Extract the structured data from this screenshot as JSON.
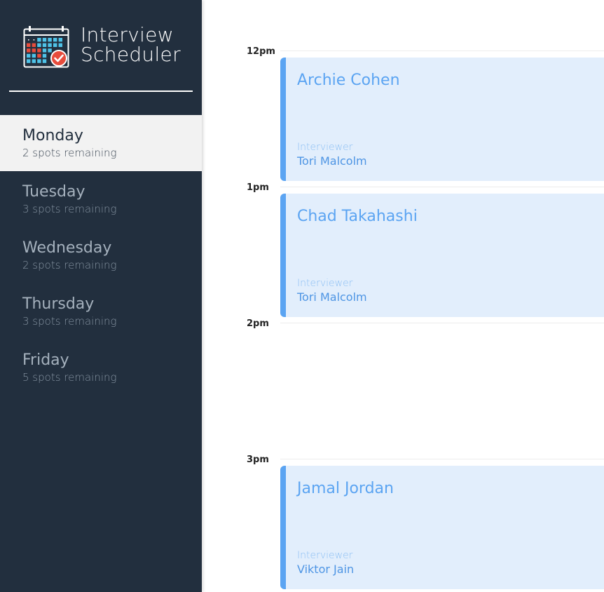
{
  "app": {
    "title_line1": "Interview",
    "title_line2": "Scheduler",
    "logo_icon": "calendar-check-icon"
  },
  "colors": {
    "sidebar_bg": "#222f3e",
    "selected_bg": "#f2f2f2",
    "card_bg": "#e2eefc",
    "accent_blue": "#5ba4f2",
    "calendar_red": "#e74c3c",
    "calendar_cyan": "#4fc3e8"
  },
  "days": [
    {
      "name": "Monday",
      "spots": "2 spots remaining",
      "selected": true
    },
    {
      "name": "Tuesday",
      "spots": "3 spots remaining",
      "selected": false
    },
    {
      "name": "Wednesday",
      "spots": "2 spots remaining",
      "selected": false
    },
    {
      "name": "Thursday",
      "spots": "3 spots remaining",
      "selected": false
    },
    {
      "name": "Friday",
      "spots": "5 spots remaining",
      "selected": false
    }
  ],
  "schedule": {
    "slots": [
      {
        "time": "12pm",
        "appointment": {
          "student": "Archie Cohen",
          "interviewer_label": "Interviewer",
          "interviewer": "Tori Malcolm"
        }
      },
      {
        "time": "1pm",
        "appointment": {
          "student": "Chad Takahashi",
          "interviewer_label": "Interviewer",
          "interviewer": "Tori Malcolm"
        }
      },
      {
        "time": "2pm",
        "appointment": null
      },
      {
        "time": "3pm",
        "appointment": {
          "student": "Jamal Jordan",
          "interviewer_label": "Interviewer",
          "interviewer": "Viktor Jain"
        }
      }
    ]
  }
}
